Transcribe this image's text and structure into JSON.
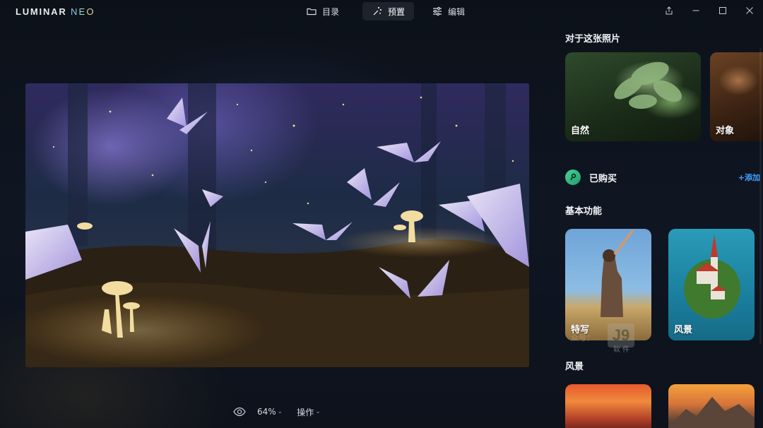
{
  "app": {
    "logo_main": "LUMINAR",
    "logo_neo": "NEO"
  },
  "nav": {
    "items": [
      {
        "label": "目录",
        "icon": "folder-icon",
        "active": false
      },
      {
        "label": "预置",
        "icon": "magic-wand-icon",
        "active": true
      },
      {
        "label": "编辑",
        "icon": "sliders-icon",
        "active": false
      }
    ]
  },
  "window_controls": [
    "share-icon",
    "minimize-icon",
    "maximize-icon",
    "close-icon"
  ],
  "viewer": {
    "zoom": "64%",
    "actions_label": "操作",
    "preview_icon": "eye-icon"
  },
  "side_panel": {
    "about_title": "对于这张照片",
    "about_cards": [
      {
        "label": "自然"
      },
      {
        "label": "对象"
      }
    ],
    "purchased": {
      "label": "已购买",
      "add_label": "+添加"
    },
    "basic_title": "基本功能",
    "basic_cards": [
      {
        "label": "特写"
      },
      {
        "label": "风景"
      }
    ],
    "landscape_title": "风景"
  },
  "watermark": {
    "logo": "J9",
    "line1": "众号：",
    "line2": "软件"
  },
  "colors": {
    "accent": "#3ea0ff",
    "badge": "#2db37e",
    "background": "#0f1622"
  }
}
